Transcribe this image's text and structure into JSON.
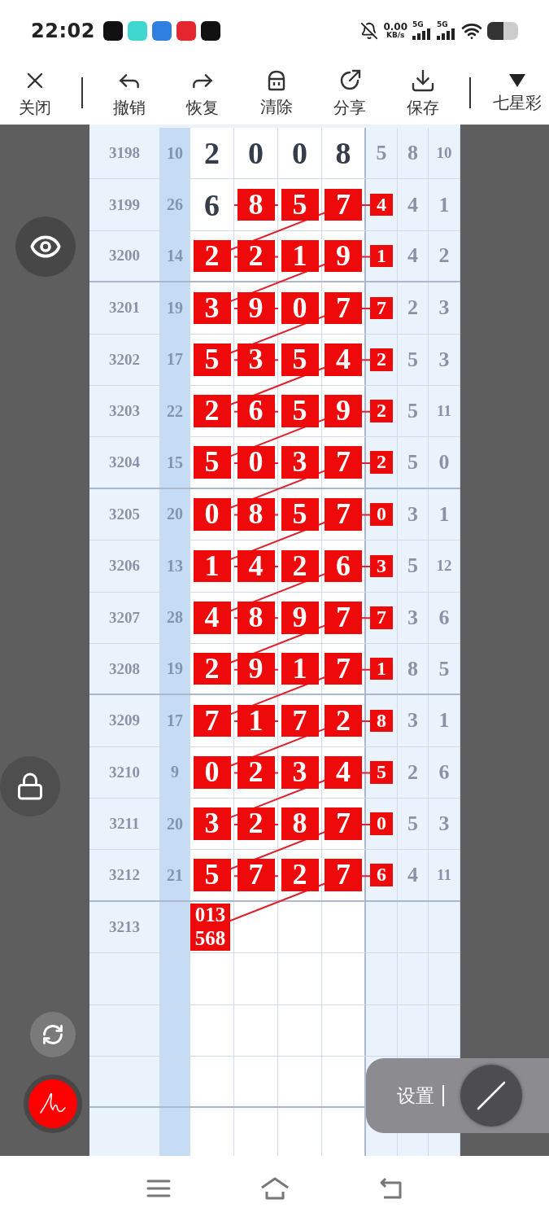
{
  "status_bar": {
    "time": "22:02",
    "net_speed": "0.00",
    "net_unit": "KB/s",
    "signals": [
      {
        "label": "5G"
      },
      {
        "label": "5G"
      }
    ]
  },
  "toolbar": {
    "items": [
      {
        "label": "关闭",
        "separator_before": false
      },
      {
        "label": "撤销",
        "separator_before": true
      },
      {
        "label": "恢复",
        "separator_before": false
      },
      {
        "label": "清除",
        "separator_before": false
      },
      {
        "label": "分享",
        "separator_before": false
      },
      {
        "label": "保存",
        "separator_before": false
      },
      {
        "label": "七星彩",
        "separator_before": true
      }
    ]
  },
  "table": {
    "rows": [
      {
        "issue": "3198",
        "sum": "10",
        "digits": [
          {
            "value": "2",
            "marked": false
          },
          {
            "value": "0",
            "marked": false
          },
          {
            "value": "0",
            "marked": false
          },
          {
            "value": "8",
            "marked": false
          }
        ],
        "column_5": {
          "value": "5",
          "marked": false
        },
        "column_6": "8",
        "column_7": "10"
      },
      {
        "issue": "3199",
        "sum": "26",
        "digits": [
          {
            "value": "6",
            "marked": false
          },
          {
            "value": "8",
            "marked": true
          },
          {
            "value": "5",
            "marked": true
          },
          {
            "value": "7",
            "marked": true
          }
        ],
        "column_5": {
          "value": "4",
          "marked": true
        },
        "column_6": "4",
        "column_7": "1"
      },
      {
        "issue": "3200",
        "sum": "14",
        "digits": [
          {
            "value": "2",
            "marked": true
          },
          {
            "value": "2",
            "marked": true
          },
          {
            "value": "1",
            "marked": true
          },
          {
            "value": "9",
            "marked": true
          }
        ],
        "column_5": {
          "value": "1",
          "marked": true
        },
        "column_6": "4",
        "column_7": "2"
      },
      {
        "issue": "3201",
        "sum": "19",
        "digits": [
          {
            "value": "3",
            "marked": true
          },
          {
            "value": "9",
            "marked": true
          },
          {
            "value": "0",
            "marked": true
          },
          {
            "value": "7",
            "marked": true
          }
        ],
        "column_5": {
          "value": "7",
          "marked": true
        },
        "column_6": "2",
        "column_7": "3"
      },
      {
        "issue": "3202",
        "sum": "17",
        "digits": [
          {
            "value": "5",
            "marked": true
          },
          {
            "value": "3",
            "marked": true
          },
          {
            "value": "5",
            "marked": true
          },
          {
            "value": "4",
            "marked": true
          }
        ],
        "column_5": {
          "value": "2",
          "marked": true
        },
        "column_6": "5",
        "column_7": "3"
      },
      {
        "issue": "3203",
        "sum": "22",
        "digits": [
          {
            "value": "2",
            "marked": true
          },
          {
            "value": "6",
            "marked": true
          },
          {
            "value": "5",
            "marked": true
          },
          {
            "value": "9",
            "marked": true
          }
        ],
        "column_5": {
          "value": "2",
          "marked": true
        },
        "column_6": "5",
        "column_7": "11"
      },
      {
        "issue": "3204",
        "sum": "15",
        "digits": [
          {
            "value": "5",
            "marked": true
          },
          {
            "value": "0",
            "marked": true
          },
          {
            "value": "3",
            "marked": true
          },
          {
            "value": "7",
            "marked": true
          }
        ],
        "column_5": {
          "value": "2",
          "marked": true
        },
        "column_6": "5",
        "column_7": "0"
      },
      {
        "issue": "3205",
        "sum": "20",
        "digits": [
          {
            "value": "0",
            "marked": true
          },
          {
            "value": "8",
            "marked": true
          },
          {
            "value": "5",
            "marked": true
          },
          {
            "value": "7",
            "marked": true
          }
        ],
        "column_5": {
          "value": "0",
          "marked": true
        },
        "column_6": "3",
        "column_7": "1"
      },
      {
        "issue": "3206",
        "sum": "13",
        "digits": [
          {
            "value": "1",
            "marked": true
          },
          {
            "value": "4",
            "marked": true
          },
          {
            "value": "2",
            "marked": true
          },
          {
            "value": "6",
            "marked": true
          }
        ],
        "column_5": {
          "value": "3",
          "marked": true
        },
        "column_6": "5",
        "column_7": "12"
      },
      {
        "issue": "3207",
        "sum": "28",
        "digits": [
          {
            "value": "4",
            "marked": true
          },
          {
            "value": "8",
            "marked": true
          },
          {
            "value": "9",
            "marked": true
          },
          {
            "value": "7",
            "marked": true
          }
        ],
        "column_5": {
          "value": "7",
          "marked": true
        },
        "column_6": "3",
        "column_7": "6"
      },
      {
        "issue": "3208",
        "sum": "19",
        "digits": [
          {
            "value": "2",
            "marked": true
          },
          {
            "value": "9",
            "marked": true
          },
          {
            "value": "1",
            "marked": true
          },
          {
            "value": "7",
            "marked": true
          }
        ],
        "column_5": {
          "value": "1",
          "marked": true
        },
        "column_6": "8",
        "column_7": "5"
      },
      {
        "issue": "3209",
        "sum": "17",
        "digits": [
          {
            "value": "7",
            "marked": true
          },
          {
            "value": "1",
            "marked": true
          },
          {
            "value": "7",
            "marked": true
          },
          {
            "value": "2",
            "marked": true
          }
        ],
        "column_5": {
          "value": "8",
          "marked": true
        },
        "column_6": "3",
        "column_7": "1"
      },
      {
        "issue": "3210",
        "sum": "9",
        "digits": [
          {
            "value": "0",
            "marked": true
          },
          {
            "value": "2",
            "marked": true
          },
          {
            "value": "3",
            "marked": true
          },
          {
            "value": "4",
            "marked": true
          }
        ],
        "column_5": {
          "value": "5",
          "marked": true
        },
        "column_6": "2",
        "column_7": "6"
      },
      {
        "issue": "3211",
        "sum": "20",
        "digits": [
          {
            "value": "3",
            "marked": true
          },
          {
            "value": "2",
            "marked": true
          },
          {
            "value": "8",
            "marked": true
          },
          {
            "value": "7",
            "marked": true
          }
        ],
        "column_5": {
          "value": "0",
          "marked": true
        },
        "column_6": "5",
        "column_7": "3"
      },
      {
        "issue": "3212",
        "sum": "21",
        "digits": [
          {
            "value": "5",
            "marked": true
          },
          {
            "value": "7",
            "marked": true
          },
          {
            "value": "2",
            "marked": true
          },
          {
            "value": "7",
            "marked": true
          }
        ],
        "column_5": {
          "value": "6",
          "marked": true
        },
        "column_6": "4",
        "column_7": "11"
      },
      {
        "issue": "3213",
        "digits": [
          {
            "value": "013 568",
            "marked": true
          }
        ]
      }
    ]
  },
  "settings_popup": {
    "label": "设置"
  }
}
